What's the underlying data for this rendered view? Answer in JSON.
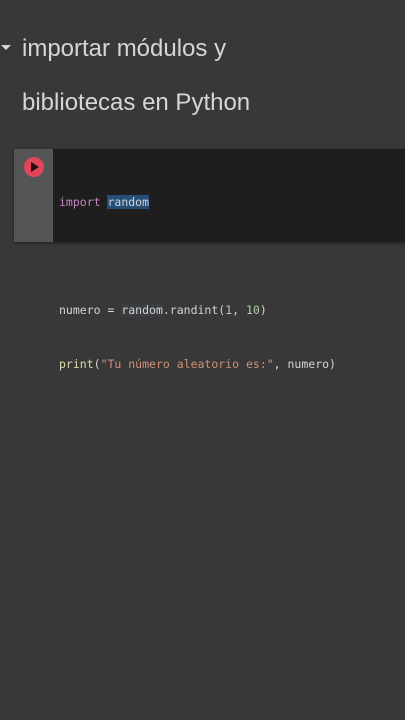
{
  "section": {
    "toggle_icon": "caret-down-icon",
    "heading_line1": "importar módulos y",
    "heading_line2": "bibliotecas en Python"
  },
  "code_cell": {
    "run_icon": "play-icon",
    "line1": {
      "keyword": "import",
      "module": "random"
    },
    "line3": {
      "var": "numero",
      "eq": " = ",
      "obj": "random",
      "call": ".randint(",
      "arg1": "1",
      "sep": ", ",
      "arg2": "10",
      "close": ")"
    },
    "line4": {
      "fn": "print",
      "open": "(",
      "str": "\"Tu número aleatorio es:\"",
      "rest": ", numero)"
    }
  },
  "colors": {
    "background": "#383838",
    "cell_background": "#1e1e1e",
    "run_button": "#e0455a",
    "keyword": "#c586c0",
    "string": "#ce9178",
    "number": "#b5cea8"
  }
}
